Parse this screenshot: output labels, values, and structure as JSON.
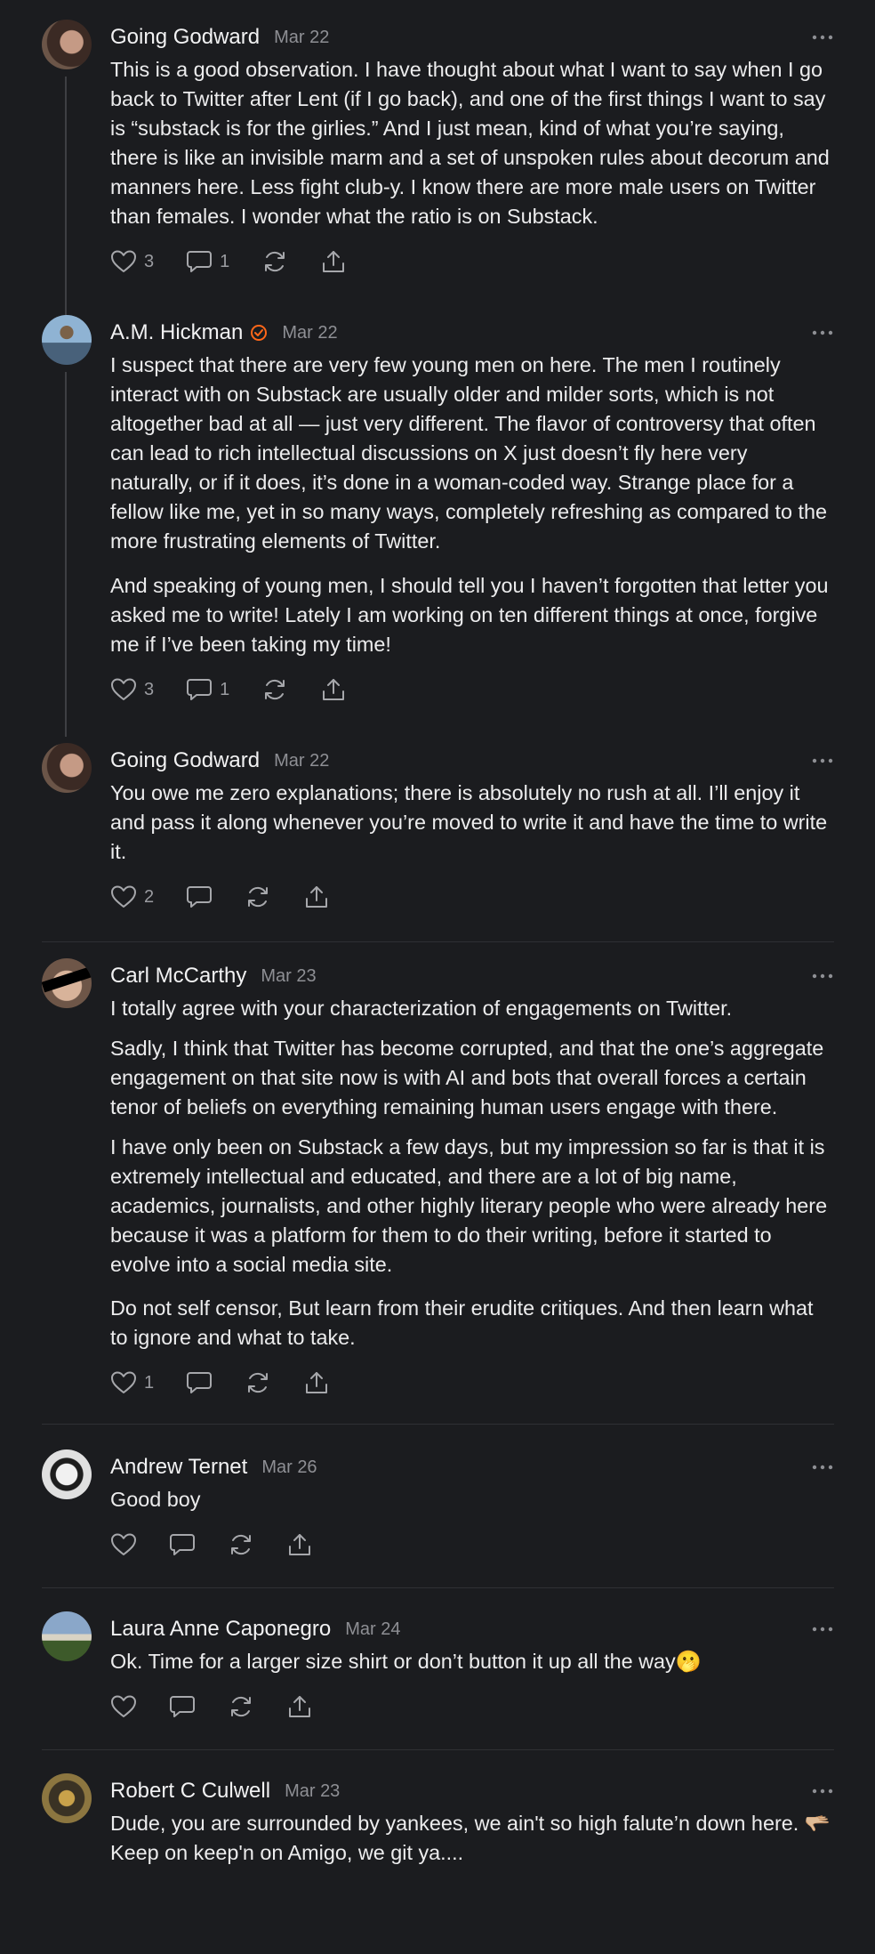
{
  "comments": [
    {
      "author": "Going Godward",
      "date": "Mar 22",
      "paragraphs": [
        "This is a good observation. I have thought about what I want to say when I go back to Twitter after Lent (if I go back), and one of the first things I want to say is “substack is for the girlies.” And I just mean, kind of what you’re saying, there is like an invisible marm and a set of unspoken rules about decorum and manners here. Less fight club-y. I know there are more male users on Twitter than females. I wonder what the ratio is on Substack."
      ],
      "likes": "3",
      "replies": "1"
    },
    {
      "author": "A.M. Hickman",
      "date": "Mar 22",
      "paragraphs": [
        "I suspect that there are very few young men on here. The men I routinely interact with on Substack are usually older and milder sorts, which is not altogether bad at all — just very different. The flavor of controversy that often can lead to rich intellectual discussions on X just doesn’t fly here very naturally, or if it does, it’s done in a woman-coded way. Strange place for a fellow like me, yet in so many ways, completely refreshing as compared to the more frustrating elements of Twitter.",
        "And speaking of young men, I should tell you I haven’t forgotten that letter you asked me to write! Lately I am working on ten different things at once, forgive me if I’ve been taking my time!"
      ],
      "likes": "3",
      "replies": "1"
    },
    {
      "author": "Going Godward",
      "date": "Mar 22",
      "paragraphs": [
        "You owe me zero explanations; there is absolutely no rush at all. I’ll enjoy it and pass it along whenever you’re moved to write it and have the time to write it."
      ],
      "likes": "2",
      "replies": ""
    },
    {
      "author": "Carl McCarthy",
      "date": "Mar 23",
      "paragraphs": [
        "I totally agree with your characterization of engagements on Twitter.",
        "Sadly, I think that Twitter has become corrupted, and that the one’s aggregate engagement on that site now is with AI and bots that overall forces a certain tenor of beliefs on everything remaining human users engage with there.",
        "I have only been on Substack a few days, but my impression so far is that it is extremely intellectual and educated, and there are a lot of big name, academics, journalists, and other highly literary people who were already here because it was a platform for them to do their writing, before it started to evolve into a social media site.",
        "Do not self censor, But learn from their erudite critiques. And then learn what to ignore and what to take."
      ],
      "likes": "1",
      "replies": ""
    },
    {
      "author": "Andrew Ternet",
      "date": "Mar 26",
      "paragraphs": [
        "Good boy"
      ],
      "likes": "",
      "replies": ""
    },
    {
      "author": "Laura Anne Caponegro",
      "date": "Mar 24",
      "paragraphs": [
        "Ok. Time for a larger size shirt or don’t button it up all the way🫢"
      ],
      "likes": "",
      "replies": ""
    },
    {
      "author": "Robert C Culwell",
      "date": "Mar 23",
      "paragraphs": [
        "Dude, you are surrounded by yankees, we ain't so high falute’n down here. 🫳🏼 Keep on keep'n on Amigo, we git ya...."
      ],
      "likes": "",
      "replies": ""
    }
  ],
  "icons": {
    "like": "heart-icon",
    "reply": "comment-bubble-icon",
    "restack": "restack-icon",
    "share": "share-icon",
    "more": "more-dots-icon",
    "verified": "verified-badge-icon"
  },
  "colors": {
    "background": "#1b1c1f",
    "text": "#ececed",
    "muted": "#8e8f94",
    "verified": "#ff6719"
  }
}
